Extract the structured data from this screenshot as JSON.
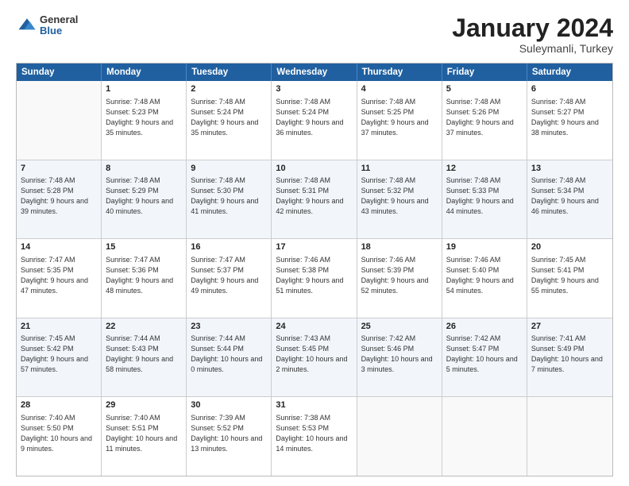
{
  "header": {
    "logo_general": "General",
    "logo_blue": "Blue",
    "month_year": "January 2024",
    "location": "Suleymanli, Turkey"
  },
  "days_of_week": [
    "Sunday",
    "Monday",
    "Tuesday",
    "Wednesday",
    "Thursday",
    "Friday",
    "Saturday"
  ],
  "weeks": [
    [
      {
        "day": "",
        "sunrise": "",
        "sunset": "",
        "daylight": "",
        "empty": true
      },
      {
        "day": "1",
        "sunrise": "Sunrise: 7:48 AM",
        "sunset": "Sunset: 5:23 PM",
        "daylight": "Daylight: 9 hours and 35 minutes."
      },
      {
        "day": "2",
        "sunrise": "Sunrise: 7:48 AM",
        "sunset": "Sunset: 5:24 PM",
        "daylight": "Daylight: 9 hours and 35 minutes."
      },
      {
        "day": "3",
        "sunrise": "Sunrise: 7:48 AM",
        "sunset": "Sunset: 5:24 PM",
        "daylight": "Daylight: 9 hours and 36 minutes."
      },
      {
        "day": "4",
        "sunrise": "Sunrise: 7:48 AM",
        "sunset": "Sunset: 5:25 PM",
        "daylight": "Daylight: 9 hours and 37 minutes."
      },
      {
        "day": "5",
        "sunrise": "Sunrise: 7:48 AM",
        "sunset": "Sunset: 5:26 PM",
        "daylight": "Daylight: 9 hours and 37 minutes."
      },
      {
        "day": "6",
        "sunrise": "Sunrise: 7:48 AM",
        "sunset": "Sunset: 5:27 PM",
        "daylight": "Daylight: 9 hours and 38 minutes."
      }
    ],
    [
      {
        "day": "7",
        "sunrise": "Sunrise: 7:48 AM",
        "sunset": "Sunset: 5:28 PM",
        "daylight": "Daylight: 9 hours and 39 minutes."
      },
      {
        "day": "8",
        "sunrise": "Sunrise: 7:48 AM",
        "sunset": "Sunset: 5:29 PM",
        "daylight": "Daylight: 9 hours and 40 minutes."
      },
      {
        "day": "9",
        "sunrise": "Sunrise: 7:48 AM",
        "sunset": "Sunset: 5:30 PM",
        "daylight": "Daylight: 9 hours and 41 minutes."
      },
      {
        "day": "10",
        "sunrise": "Sunrise: 7:48 AM",
        "sunset": "Sunset: 5:31 PM",
        "daylight": "Daylight: 9 hours and 42 minutes."
      },
      {
        "day": "11",
        "sunrise": "Sunrise: 7:48 AM",
        "sunset": "Sunset: 5:32 PM",
        "daylight": "Daylight: 9 hours and 43 minutes."
      },
      {
        "day": "12",
        "sunrise": "Sunrise: 7:48 AM",
        "sunset": "Sunset: 5:33 PM",
        "daylight": "Daylight: 9 hours and 44 minutes."
      },
      {
        "day": "13",
        "sunrise": "Sunrise: 7:48 AM",
        "sunset": "Sunset: 5:34 PM",
        "daylight": "Daylight: 9 hours and 46 minutes."
      }
    ],
    [
      {
        "day": "14",
        "sunrise": "Sunrise: 7:47 AM",
        "sunset": "Sunset: 5:35 PM",
        "daylight": "Daylight: 9 hours and 47 minutes."
      },
      {
        "day": "15",
        "sunrise": "Sunrise: 7:47 AM",
        "sunset": "Sunset: 5:36 PM",
        "daylight": "Daylight: 9 hours and 48 minutes."
      },
      {
        "day": "16",
        "sunrise": "Sunrise: 7:47 AM",
        "sunset": "Sunset: 5:37 PM",
        "daylight": "Daylight: 9 hours and 49 minutes."
      },
      {
        "day": "17",
        "sunrise": "Sunrise: 7:46 AM",
        "sunset": "Sunset: 5:38 PM",
        "daylight": "Daylight: 9 hours and 51 minutes."
      },
      {
        "day": "18",
        "sunrise": "Sunrise: 7:46 AM",
        "sunset": "Sunset: 5:39 PM",
        "daylight": "Daylight: 9 hours and 52 minutes."
      },
      {
        "day": "19",
        "sunrise": "Sunrise: 7:46 AM",
        "sunset": "Sunset: 5:40 PM",
        "daylight": "Daylight: 9 hours and 54 minutes."
      },
      {
        "day": "20",
        "sunrise": "Sunrise: 7:45 AM",
        "sunset": "Sunset: 5:41 PM",
        "daylight": "Daylight: 9 hours and 55 minutes."
      }
    ],
    [
      {
        "day": "21",
        "sunrise": "Sunrise: 7:45 AM",
        "sunset": "Sunset: 5:42 PM",
        "daylight": "Daylight: 9 hours and 57 minutes."
      },
      {
        "day": "22",
        "sunrise": "Sunrise: 7:44 AM",
        "sunset": "Sunset: 5:43 PM",
        "daylight": "Daylight: 9 hours and 58 minutes."
      },
      {
        "day": "23",
        "sunrise": "Sunrise: 7:44 AM",
        "sunset": "Sunset: 5:44 PM",
        "daylight": "Daylight: 10 hours and 0 minutes."
      },
      {
        "day": "24",
        "sunrise": "Sunrise: 7:43 AM",
        "sunset": "Sunset: 5:45 PM",
        "daylight": "Daylight: 10 hours and 2 minutes."
      },
      {
        "day": "25",
        "sunrise": "Sunrise: 7:42 AM",
        "sunset": "Sunset: 5:46 PM",
        "daylight": "Daylight: 10 hours and 3 minutes."
      },
      {
        "day": "26",
        "sunrise": "Sunrise: 7:42 AM",
        "sunset": "Sunset: 5:47 PM",
        "daylight": "Daylight: 10 hours and 5 minutes."
      },
      {
        "day": "27",
        "sunrise": "Sunrise: 7:41 AM",
        "sunset": "Sunset: 5:49 PM",
        "daylight": "Daylight: 10 hours and 7 minutes."
      }
    ],
    [
      {
        "day": "28",
        "sunrise": "Sunrise: 7:40 AM",
        "sunset": "Sunset: 5:50 PM",
        "daylight": "Daylight: 10 hours and 9 minutes."
      },
      {
        "day": "29",
        "sunrise": "Sunrise: 7:40 AM",
        "sunset": "Sunset: 5:51 PM",
        "daylight": "Daylight: 10 hours and 11 minutes."
      },
      {
        "day": "30",
        "sunrise": "Sunrise: 7:39 AM",
        "sunset": "Sunset: 5:52 PM",
        "daylight": "Daylight: 10 hours and 13 minutes."
      },
      {
        "day": "31",
        "sunrise": "Sunrise: 7:38 AM",
        "sunset": "Sunset: 5:53 PM",
        "daylight": "Daylight: 10 hours and 14 minutes."
      },
      {
        "day": "",
        "sunrise": "",
        "sunset": "",
        "daylight": "",
        "empty": true
      },
      {
        "day": "",
        "sunrise": "",
        "sunset": "",
        "daylight": "",
        "empty": true
      },
      {
        "day": "",
        "sunrise": "",
        "sunset": "",
        "daylight": "",
        "empty": true
      }
    ]
  ]
}
